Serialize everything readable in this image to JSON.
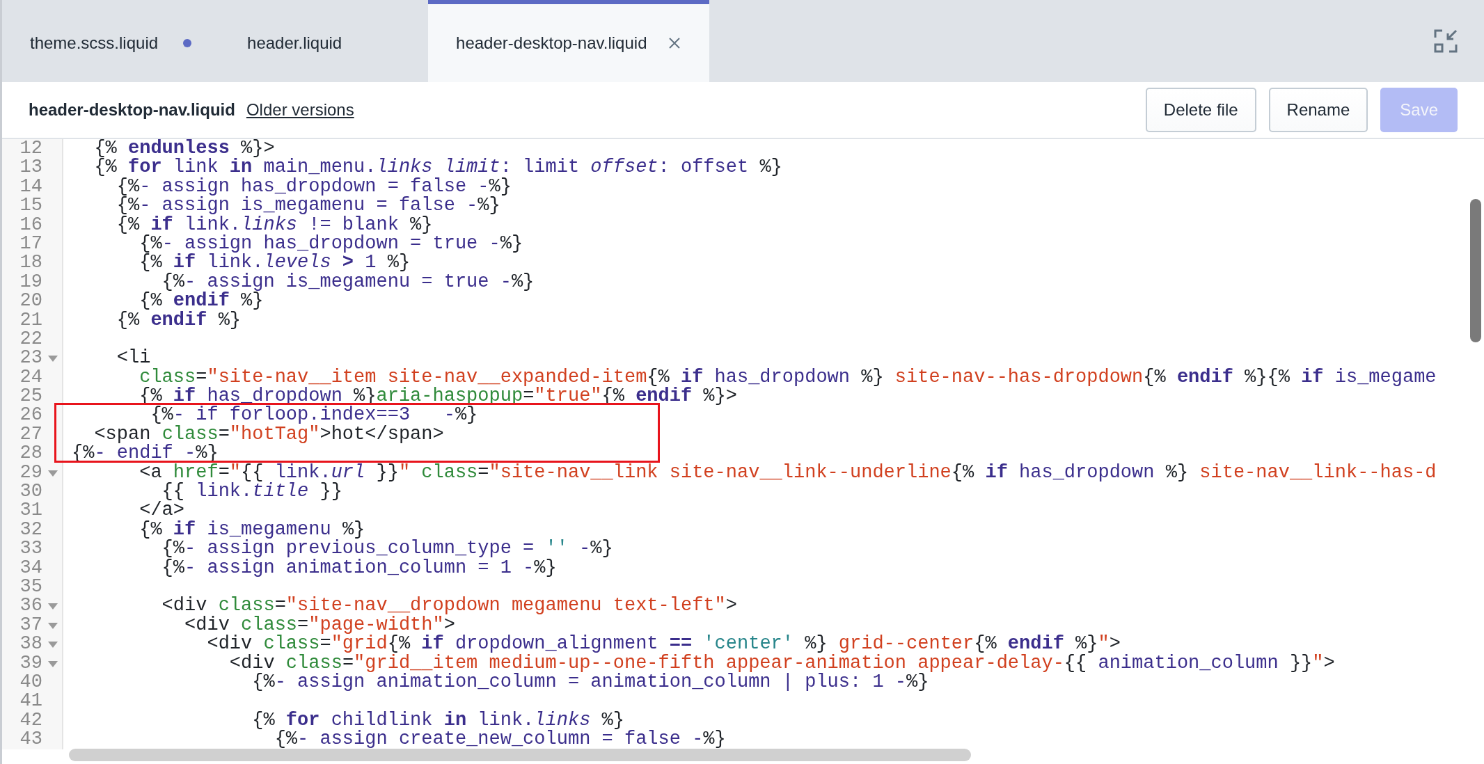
{
  "tabs": [
    {
      "label": "theme.scss.liquid",
      "selected": false,
      "modified": true
    },
    {
      "label": "header.liquid",
      "selected": false,
      "modified": false
    },
    {
      "label": "header-desktop-nav.liquid",
      "selected": true,
      "modified": false
    }
  ],
  "file_header": {
    "filename": "header-desktop-nav.liquid",
    "link": "Older versions",
    "buttons": [
      {
        "label": "Delete file",
        "kind": "secondary",
        "disabled": false
      },
      {
        "label": "Rename",
        "kind": "secondary",
        "disabled": false
      },
      {
        "label": "Save",
        "kind": "primary",
        "disabled": true
      }
    ]
  },
  "editor": {
    "lines": [
      {
        "number": "12",
        "foldable": false,
        "highlighted": false,
        "segments": [
          {
            "kind": "plain",
            "text": "  {% "
          },
          {
            "kind": "keyword",
            "text": "endunless"
          },
          {
            "kind": "plain",
            "text": " %}>"
          }
        ]
      },
      {
        "number": "13",
        "foldable": false,
        "highlighted": false,
        "segments": [
          {
            "kind": "plain",
            "text": "  {% "
          },
          {
            "kind": "keyword",
            "text": "for"
          },
          {
            "kind": "name",
            "text": " link "
          },
          {
            "kind": "keyword",
            "text": "in"
          },
          {
            "kind": "name",
            "text": " main_menu."
          },
          {
            "kind": "property",
            "text": "links"
          },
          {
            "kind": "property",
            "text": " limit"
          },
          {
            "kind": "name",
            "text": ": limit "
          },
          {
            "kind": "property",
            "text": "offset"
          },
          {
            "kind": "name",
            "text": ": offset "
          },
          {
            "kind": "plain",
            "text": "%}"
          }
        ]
      },
      {
        "number": "14",
        "foldable": false,
        "highlighted": false,
        "segments": [
          {
            "kind": "plain",
            "text": "    {%"
          },
          {
            "kind": "name",
            "text": "- assign has_dropdown = false -"
          },
          {
            "kind": "plain",
            "text": "%}"
          }
        ]
      },
      {
        "number": "15",
        "foldable": false,
        "highlighted": false,
        "segments": [
          {
            "kind": "plain",
            "text": "    {%"
          },
          {
            "kind": "name",
            "text": "- assign is_megamenu = false -"
          },
          {
            "kind": "plain",
            "text": "%}"
          }
        ]
      },
      {
        "number": "16",
        "foldable": false,
        "highlighted": false,
        "segments": [
          {
            "kind": "plain",
            "text": "    {% "
          },
          {
            "kind": "keyword",
            "text": "if"
          },
          {
            "kind": "name",
            "text": " link."
          },
          {
            "kind": "property",
            "text": "links"
          },
          {
            "kind": "name",
            "text": " != blank "
          },
          {
            "kind": "plain",
            "text": "%}"
          }
        ]
      },
      {
        "number": "17",
        "foldable": false,
        "highlighted": false,
        "segments": [
          {
            "kind": "plain",
            "text": "      {%"
          },
          {
            "kind": "name",
            "text": "- assign has_dropdown = true -"
          },
          {
            "kind": "plain",
            "text": "%}"
          }
        ]
      },
      {
        "number": "18",
        "foldable": false,
        "highlighted": false,
        "segments": [
          {
            "kind": "plain",
            "text": "      {% "
          },
          {
            "kind": "keyword",
            "text": "if"
          },
          {
            "kind": "name",
            "text": " link."
          },
          {
            "kind": "property",
            "text": "levels"
          },
          {
            "kind": "keyword",
            "text": " >"
          },
          {
            "kind": "name",
            "text": " 1 "
          },
          {
            "kind": "plain",
            "text": "%}"
          }
        ]
      },
      {
        "number": "19",
        "foldable": false,
        "highlighted": false,
        "segments": [
          {
            "kind": "plain",
            "text": "        {%"
          },
          {
            "kind": "name",
            "text": "- assign is_megamenu = true -"
          },
          {
            "kind": "plain",
            "text": "%}"
          }
        ]
      },
      {
        "number": "20",
        "foldable": false,
        "highlighted": false,
        "segments": [
          {
            "kind": "plain",
            "text": "      {% "
          },
          {
            "kind": "keyword",
            "text": "endif"
          },
          {
            "kind": "plain",
            "text": " %}"
          }
        ]
      },
      {
        "number": "21",
        "foldable": false,
        "highlighted": false,
        "segments": [
          {
            "kind": "plain",
            "text": "    {% "
          },
          {
            "kind": "keyword",
            "text": "endif"
          },
          {
            "kind": "plain",
            "text": " %}"
          }
        ]
      },
      {
        "number": "22",
        "foldable": false,
        "highlighted": false
      },
      {
        "number": "23",
        "foldable": true,
        "highlighted": false,
        "segments": [
          {
            "kind": "plain",
            "text": "    <li"
          }
        ]
      },
      {
        "number": "24",
        "foldable": false,
        "highlighted": false,
        "segments": [
          {
            "kind": "attribute",
            "text": "      class"
          },
          {
            "kind": "plain",
            "text": "="
          },
          {
            "kind": "string",
            "text": "\"site-nav__item site-nav__expanded-item"
          },
          {
            "kind": "plain",
            "text": "{% "
          },
          {
            "kind": "keyword",
            "text": "if"
          },
          {
            "kind": "name",
            "text": " has_dropdown "
          },
          {
            "kind": "plain",
            "text": "%}"
          },
          {
            "kind": "string",
            "text": " site-nav--has-dropdown"
          },
          {
            "kind": "plain",
            "text": "{% "
          },
          {
            "kind": "keyword",
            "text": "endif"
          },
          {
            "kind": "plain",
            "text": " %}{% "
          },
          {
            "kind": "keyword",
            "text": "if"
          },
          {
            "kind": "name",
            "text": " is_megame"
          }
        ]
      },
      {
        "number": "25",
        "foldable": false,
        "highlighted": false,
        "segments": [
          {
            "kind": "plain",
            "text": "      {% "
          },
          {
            "kind": "keyword",
            "text": "if"
          },
          {
            "kind": "name",
            "text": " has_dropdown "
          },
          {
            "kind": "plain",
            "text": "%}"
          },
          {
            "kind": "attribute",
            "text": "aria-haspopup"
          },
          {
            "kind": "plain",
            "text": "="
          },
          {
            "kind": "string",
            "text": "\"true\""
          },
          {
            "kind": "plain",
            "text": "{% "
          },
          {
            "kind": "keyword",
            "text": "endif"
          },
          {
            "kind": "plain",
            "text": " %}>"
          }
        ]
      },
      {
        "number": "26",
        "foldable": false,
        "highlighted": true,
        "segments": [
          {
            "kind": "plain",
            "text": "       {%"
          },
          {
            "kind": "name",
            "text": "- if forloop.index==3   -"
          },
          {
            "kind": "plain",
            "text": "%}"
          }
        ]
      },
      {
        "number": "27",
        "foldable": false,
        "highlighted": true,
        "segments": [
          {
            "kind": "plain",
            "text": "  <span "
          },
          {
            "kind": "attribute",
            "text": "class"
          },
          {
            "kind": "plain",
            "text": "="
          },
          {
            "kind": "string",
            "text": "\"hotTag\""
          },
          {
            "kind": "plain",
            "text": ">hot</span>"
          }
        ]
      },
      {
        "number": "28",
        "foldable": false,
        "highlighted": true,
        "segments": [
          {
            "kind": "plain",
            "text": "{%"
          },
          {
            "kind": "name",
            "text": "- endif -"
          },
          {
            "kind": "plain",
            "text": "%}"
          }
        ]
      },
      {
        "number": "29",
        "foldable": true,
        "highlighted": false,
        "segments": [
          {
            "kind": "plain",
            "text": "      <a "
          },
          {
            "kind": "attribute",
            "text": "href"
          },
          {
            "kind": "plain",
            "text": "="
          },
          {
            "kind": "string",
            "text": "\""
          },
          {
            "kind": "plain",
            "text": "{{ "
          },
          {
            "kind": "name",
            "text": "link."
          },
          {
            "kind": "property",
            "text": "url"
          },
          {
            "kind": "plain",
            "text": " }}"
          },
          {
            "kind": "string",
            "text": "\""
          },
          {
            "kind": "attribute",
            "text": " class"
          },
          {
            "kind": "plain",
            "text": "="
          },
          {
            "kind": "string",
            "text": "\"site-nav__link site-nav__link--underline"
          },
          {
            "kind": "plain",
            "text": "{% "
          },
          {
            "kind": "keyword",
            "text": "if"
          },
          {
            "kind": "name",
            "text": " has_dropdown "
          },
          {
            "kind": "plain",
            "text": "%}"
          },
          {
            "kind": "string",
            "text": " site-nav__link--has-d"
          }
        ]
      },
      {
        "number": "30",
        "foldable": false,
        "highlighted": false,
        "segments": [
          {
            "kind": "plain",
            "text": "        {{ "
          },
          {
            "kind": "name",
            "text": "link."
          },
          {
            "kind": "property",
            "text": "title"
          },
          {
            "kind": "plain",
            "text": " }}"
          }
        ]
      },
      {
        "number": "31",
        "foldable": false,
        "highlighted": false,
        "segments": [
          {
            "kind": "plain",
            "text": "      </a>"
          }
        ]
      },
      {
        "number": "32",
        "foldable": false,
        "highlighted": false,
        "segments": [
          {
            "kind": "plain",
            "text": "      {% "
          },
          {
            "kind": "keyword",
            "text": "if"
          },
          {
            "kind": "name",
            "text": " is_megamenu "
          },
          {
            "kind": "plain",
            "text": "%}"
          }
        ]
      },
      {
        "number": "33",
        "foldable": false,
        "highlighted": false,
        "segments": [
          {
            "kind": "plain",
            "text": "        {%"
          },
          {
            "kind": "name",
            "text": "- assign previous_column_type = "
          },
          {
            "kind": "literal",
            "text": "''"
          },
          {
            "kind": "name",
            "text": " -"
          },
          {
            "kind": "plain",
            "text": "%}"
          }
        ]
      },
      {
        "number": "34",
        "foldable": false,
        "highlighted": false,
        "segments": [
          {
            "kind": "plain",
            "text": "        {%"
          },
          {
            "kind": "name",
            "text": "- assign animation_column = 1 -"
          },
          {
            "kind": "plain",
            "text": "%}"
          }
        ]
      },
      {
        "number": "35",
        "foldable": false,
        "highlighted": false
      },
      {
        "number": "36",
        "foldable": true,
        "highlighted": false,
        "segments": [
          {
            "kind": "plain",
            "text": "        <div "
          },
          {
            "kind": "attribute",
            "text": "class"
          },
          {
            "kind": "plain",
            "text": "="
          },
          {
            "kind": "string",
            "text": "\"site-nav__dropdown megamenu text-left\""
          },
          {
            "kind": "plain",
            "text": ">"
          }
        ]
      },
      {
        "number": "37",
        "foldable": true,
        "highlighted": false,
        "segments": [
          {
            "kind": "plain",
            "text": "          <div "
          },
          {
            "kind": "attribute",
            "text": "class"
          },
          {
            "kind": "plain",
            "text": "="
          },
          {
            "kind": "string",
            "text": "\"page-width\""
          },
          {
            "kind": "plain",
            "text": ">"
          }
        ]
      },
      {
        "number": "38",
        "foldable": true,
        "highlighted": false,
        "segments": [
          {
            "kind": "plain",
            "text": "            <div "
          },
          {
            "kind": "attribute",
            "text": "class"
          },
          {
            "kind": "plain",
            "text": "="
          },
          {
            "kind": "string",
            "text": "\"grid"
          },
          {
            "kind": "plain",
            "text": "{% "
          },
          {
            "kind": "keyword",
            "text": "if"
          },
          {
            "kind": "name",
            "text": " dropdown_alignment "
          },
          {
            "kind": "keyword",
            "text": "=="
          },
          {
            "kind": "literal",
            "text": " 'center'"
          },
          {
            "kind": "plain",
            "text": " %}"
          },
          {
            "kind": "string",
            "text": " grid--center"
          },
          {
            "kind": "plain",
            "text": "{% "
          },
          {
            "kind": "keyword",
            "text": "endif"
          },
          {
            "kind": "plain",
            "text": " %}"
          },
          {
            "kind": "string",
            "text": "\""
          },
          {
            "kind": "plain",
            "text": ">"
          }
        ]
      },
      {
        "number": "39",
        "foldable": true,
        "highlighted": false,
        "segments": [
          {
            "kind": "plain",
            "text": "              <div "
          },
          {
            "kind": "attribute",
            "text": "class"
          },
          {
            "kind": "plain",
            "text": "="
          },
          {
            "kind": "string",
            "text": "\"grid__item medium-up--one-fifth appear-animation appear-delay-"
          },
          {
            "kind": "plain",
            "text": "{{ "
          },
          {
            "kind": "name",
            "text": "animation_column "
          },
          {
            "kind": "plain",
            "text": "}}"
          },
          {
            "kind": "string",
            "text": "\""
          },
          {
            "kind": "plain",
            "text": ">"
          }
        ]
      },
      {
        "number": "40",
        "foldable": false,
        "highlighted": false,
        "segments": [
          {
            "kind": "plain",
            "text": "                {%"
          },
          {
            "kind": "name",
            "text": "- assign animation_column = animation_column | plus: 1 -"
          },
          {
            "kind": "plain",
            "text": "%}"
          }
        ]
      },
      {
        "number": "41",
        "foldable": false,
        "highlighted": false
      },
      {
        "number": "42",
        "foldable": false,
        "highlighted": false,
        "segments": [
          {
            "kind": "plain",
            "text": "                {% "
          },
          {
            "kind": "keyword",
            "text": "for"
          },
          {
            "kind": "name",
            "text": " childlink "
          },
          {
            "kind": "keyword",
            "text": "in"
          },
          {
            "kind": "name",
            "text": " link."
          },
          {
            "kind": "property",
            "text": "links"
          },
          {
            "kind": "plain",
            "text": " %}"
          }
        ]
      },
      {
        "number": "43",
        "foldable": false,
        "highlighted": false,
        "segments": [
          {
            "kind": "plain",
            "text": "                  {%"
          },
          {
            "kind": "name",
            "text": "- assign create_new_column = false -"
          },
          {
            "kind": "plain",
            "text": "%}"
          }
        ]
      }
    ]
  }
}
